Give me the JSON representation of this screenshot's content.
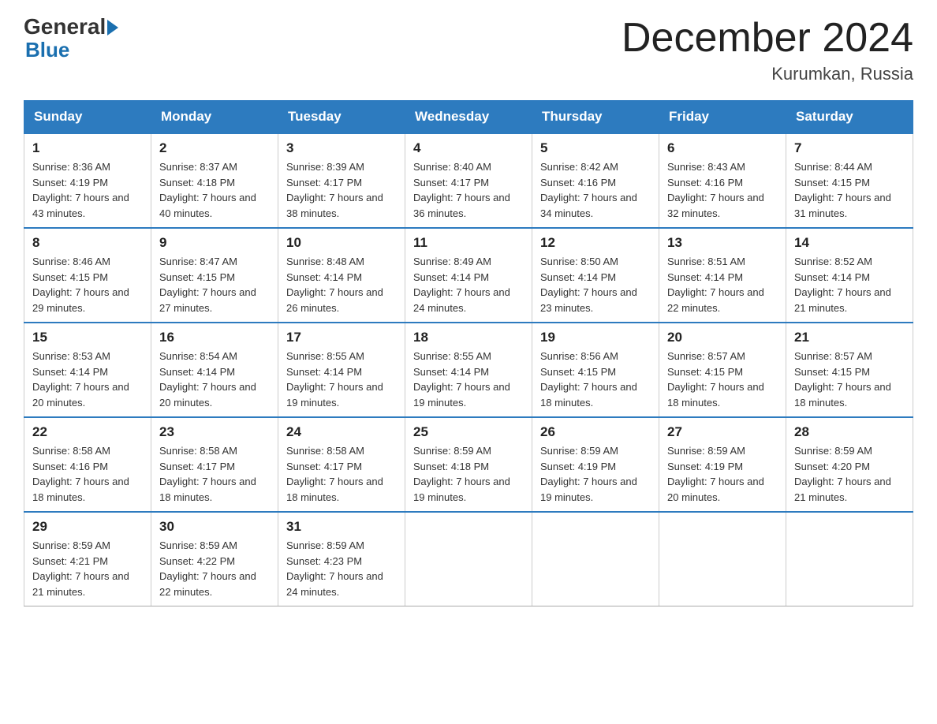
{
  "header": {
    "logo_general": "General",
    "logo_blue": "Blue",
    "month_title": "December 2024",
    "location": "Kurumkan, Russia"
  },
  "weekdays": [
    "Sunday",
    "Monday",
    "Tuesday",
    "Wednesday",
    "Thursday",
    "Friday",
    "Saturday"
  ],
  "weeks": [
    [
      {
        "day": "1",
        "sunrise": "8:36 AM",
        "sunset": "4:19 PM",
        "daylight": "7 hours and 43 minutes."
      },
      {
        "day": "2",
        "sunrise": "8:37 AM",
        "sunset": "4:18 PM",
        "daylight": "7 hours and 40 minutes."
      },
      {
        "day": "3",
        "sunrise": "8:39 AM",
        "sunset": "4:17 PM",
        "daylight": "7 hours and 38 minutes."
      },
      {
        "day": "4",
        "sunrise": "8:40 AM",
        "sunset": "4:17 PM",
        "daylight": "7 hours and 36 minutes."
      },
      {
        "day": "5",
        "sunrise": "8:42 AM",
        "sunset": "4:16 PM",
        "daylight": "7 hours and 34 minutes."
      },
      {
        "day": "6",
        "sunrise": "8:43 AM",
        "sunset": "4:16 PM",
        "daylight": "7 hours and 32 minutes."
      },
      {
        "day": "7",
        "sunrise": "8:44 AM",
        "sunset": "4:15 PM",
        "daylight": "7 hours and 31 minutes."
      }
    ],
    [
      {
        "day": "8",
        "sunrise": "8:46 AM",
        "sunset": "4:15 PM",
        "daylight": "7 hours and 29 minutes."
      },
      {
        "day": "9",
        "sunrise": "8:47 AM",
        "sunset": "4:15 PM",
        "daylight": "7 hours and 27 minutes."
      },
      {
        "day": "10",
        "sunrise": "8:48 AM",
        "sunset": "4:14 PM",
        "daylight": "7 hours and 26 minutes."
      },
      {
        "day": "11",
        "sunrise": "8:49 AM",
        "sunset": "4:14 PM",
        "daylight": "7 hours and 24 minutes."
      },
      {
        "day": "12",
        "sunrise": "8:50 AM",
        "sunset": "4:14 PM",
        "daylight": "7 hours and 23 minutes."
      },
      {
        "day": "13",
        "sunrise": "8:51 AM",
        "sunset": "4:14 PM",
        "daylight": "7 hours and 22 minutes."
      },
      {
        "day": "14",
        "sunrise": "8:52 AM",
        "sunset": "4:14 PM",
        "daylight": "7 hours and 21 minutes."
      }
    ],
    [
      {
        "day": "15",
        "sunrise": "8:53 AM",
        "sunset": "4:14 PM",
        "daylight": "7 hours and 20 minutes."
      },
      {
        "day": "16",
        "sunrise": "8:54 AM",
        "sunset": "4:14 PM",
        "daylight": "7 hours and 20 minutes."
      },
      {
        "day": "17",
        "sunrise": "8:55 AM",
        "sunset": "4:14 PM",
        "daylight": "7 hours and 19 minutes."
      },
      {
        "day": "18",
        "sunrise": "8:55 AM",
        "sunset": "4:14 PM",
        "daylight": "7 hours and 19 minutes."
      },
      {
        "day": "19",
        "sunrise": "8:56 AM",
        "sunset": "4:15 PM",
        "daylight": "7 hours and 18 minutes."
      },
      {
        "day": "20",
        "sunrise": "8:57 AM",
        "sunset": "4:15 PM",
        "daylight": "7 hours and 18 minutes."
      },
      {
        "day": "21",
        "sunrise": "8:57 AM",
        "sunset": "4:15 PM",
        "daylight": "7 hours and 18 minutes."
      }
    ],
    [
      {
        "day": "22",
        "sunrise": "8:58 AM",
        "sunset": "4:16 PM",
        "daylight": "7 hours and 18 minutes."
      },
      {
        "day": "23",
        "sunrise": "8:58 AM",
        "sunset": "4:17 PM",
        "daylight": "7 hours and 18 minutes."
      },
      {
        "day": "24",
        "sunrise": "8:58 AM",
        "sunset": "4:17 PM",
        "daylight": "7 hours and 18 minutes."
      },
      {
        "day": "25",
        "sunrise": "8:59 AM",
        "sunset": "4:18 PM",
        "daylight": "7 hours and 19 minutes."
      },
      {
        "day": "26",
        "sunrise": "8:59 AM",
        "sunset": "4:19 PM",
        "daylight": "7 hours and 19 minutes."
      },
      {
        "day": "27",
        "sunrise": "8:59 AM",
        "sunset": "4:19 PM",
        "daylight": "7 hours and 20 minutes."
      },
      {
        "day": "28",
        "sunrise": "8:59 AM",
        "sunset": "4:20 PM",
        "daylight": "7 hours and 21 minutes."
      }
    ],
    [
      {
        "day": "29",
        "sunrise": "8:59 AM",
        "sunset": "4:21 PM",
        "daylight": "7 hours and 21 minutes."
      },
      {
        "day": "30",
        "sunrise": "8:59 AM",
        "sunset": "4:22 PM",
        "daylight": "7 hours and 22 minutes."
      },
      {
        "day": "31",
        "sunrise": "8:59 AM",
        "sunset": "4:23 PM",
        "daylight": "7 hours and 24 minutes."
      },
      null,
      null,
      null,
      null
    ]
  ]
}
